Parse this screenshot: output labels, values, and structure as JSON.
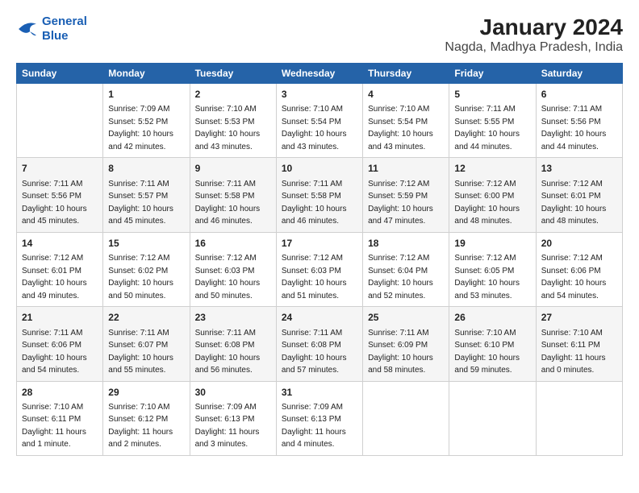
{
  "logo": {
    "line1": "General",
    "line2": "Blue"
  },
  "title": "January 2024",
  "subtitle": "Nagda, Madhya Pradesh, India",
  "columns": [
    "Sunday",
    "Monday",
    "Tuesday",
    "Wednesday",
    "Thursday",
    "Friday",
    "Saturday"
  ],
  "weeks": [
    [
      {
        "day": "",
        "info": ""
      },
      {
        "day": "1",
        "info": "Sunrise: 7:09 AM\nSunset: 5:52 PM\nDaylight: 10 hours\nand 42 minutes."
      },
      {
        "day": "2",
        "info": "Sunrise: 7:10 AM\nSunset: 5:53 PM\nDaylight: 10 hours\nand 43 minutes."
      },
      {
        "day": "3",
        "info": "Sunrise: 7:10 AM\nSunset: 5:54 PM\nDaylight: 10 hours\nand 43 minutes."
      },
      {
        "day": "4",
        "info": "Sunrise: 7:10 AM\nSunset: 5:54 PM\nDaylight: 10 hours\nand 43 minutes."
      },
      {
        "day": "5",
        "info": "Sunrise: 7:11 AM\nSunset: 5:55 PM\nDaylight: 10 hours\nand 44 minutes."
      },
      {
        "day": "6",
        "info": "Sunrise: 7:11 AM\nSunset: 5:56 PM\nDaylight: 10 hours\nand 44 minutes."
      }
    ],
    [
      {
        "day": "7",
        "info": "Sunrise: 7:11 AM\nSunset: 5:56 PM\nDaylight: 10 hours\nand 45 minutes."
      },
      {
        "day": "8",
        "info": "Sunrise: 7:11 AM\nSunset: 5:57 PM\nDaylight: 10 hours\nand 45 minutes."
      },
      {
        "day": "9",
        "info": "Sunrise: 7:11 AM\nSunset: 5:58 PM\nDaylight: 10 hours\nand 46 minutes."
      },
      {
        "day": "10",
        "info": "Sunrise: 7:11 AM\nSunset: 5:58 PM\nDaylight: 10 hours\nand 46 minutes."
      },
      {
        "day": "11",
        "info": "Sunrise: 7:12 AM\nSunset: 5:59 PM\nDaylight: 10 hours\nand 47 minutes."
      },
      {
        "day": "12",
        "info": "Sunrise: 7:12 AM\nSunset: 6:00 PM\nDaylight: 10 hours\nand 48 minutes."
      },
      {
        "day": "13",
        "info": "Sunrise: 7:12 AM\nSunset: 6:01 PM\nDaylight: 10 hours\nand 48 minutes."
      }
    ],
    [
      {
        "day": "14",
        "info": "Sunrise: 7:12 AM\nSunset: 6:01 PM\nDaylight: 10 hours\nand 49 minutes."
      },
      {
        "day": "15",
        "info": "Sunrise: 7:12 AM\nSunset: 6:02 PM\nDaylight: 10 hours\nand 50 minutes."
      },
      {
        "day": "16",
        "info": "Sunrise: 7:12 AM\nSunset: 6:03 PM\nDaylight: 10 hours\nand 50 minutes."
      },
      {
        "day": "17",
        "info": "Sunrise: 7:12 AM\nSunset: 6:03 PM\nDaylight: 10 hours\nand 51 minutes."
      },
      {
        "day": "18",
        "info": "Sunrise: 7:12 AM\nSunset: 6:04 PM\nDaylight: 10 hours\nand 52 minutes."
      },
      {
        "day": "19",
        "info": "Sunrise: 7:12 AM\nSunset: 6:05 PM\nDaylight: 10 hours\nand 53 minutes."
      },
      {
        "day": "20",
        "info": "Sunrise: 7:12 AM\nSunset: 6:06 PM\nDaylight: 10 hours\nand 54 minutes."
      }
    ],
    [
      {
        "day": "21",
        "info": "Sunrise: 7:11 AM\nSunset: 6:06 PM\nDaylight: 10 hours\nand 54 minutes."
      },
      {
        "day": "22",
        "info": "Sunrise: 7:11 AM\nSunset: 6:07 PM\nDaylight: 10 hours\nand 55 minutes."
      },
      {
        "day": "23",
        "info": "Sunrise: 7:11 AM\nSunset: 6:08 PM\nDaylight: 10 hours\nand 56 minutes."
      },
      {
        "day": "24",
        "info": "Sunrise: 7:11 AM\nSunset: 6:08 PM\nDaylight: 10 hours\nand 57 minutes."
      },
      {
        "day": "25",
        "info": "Sunrise: 7:11 AM\nSunset: 6:09 PM\nDaylight: 10 hours\nand 58 minutes."
      },
      {
        "day": "26",
        "info": "Sunrise: 7:10 AM\nSunset: 6:10 PM\nDaylight: 10 hours\nand 59 minutes."
      },
      {
        "day": "27",
        "info": "Sunrise: 7:10 AM\nSunset: 6:11 PM\nDaylight: 11 hours\nand 0 minutes."
      }
    ],
    [
      {
        "day": "28",
        "info": "Sunrise: 7:10 AM\nSunset: 6:11 PM\nDaylight: 11 hours\nand 1 minute."
      },
      {
        "day": "29",
        "info": "Sunrise: 7:10 AM\nSunset: 6:12 PM\nDaylight: 11 hours\nand 2 minutes."
      },
      {
        "day": "30",
        "info": "Sunrise: 7:09 AM\nSunset: 6:13 PM\nDaylight: 11 hours\nand 3 minutes."
      },
      {
        "day": "31",
        "info": "Sunrise: 7:09 AM\nSunset: 6:13 PM\nDaylight: 11 hours\nand 4 minutes."
      },
      {
        "day": "",
        "info": ""
      },
      {
        "day": "",
        "info": ""
      },
      {
        "day": "",
        "info": ""
      }
    ]
  ]
}
